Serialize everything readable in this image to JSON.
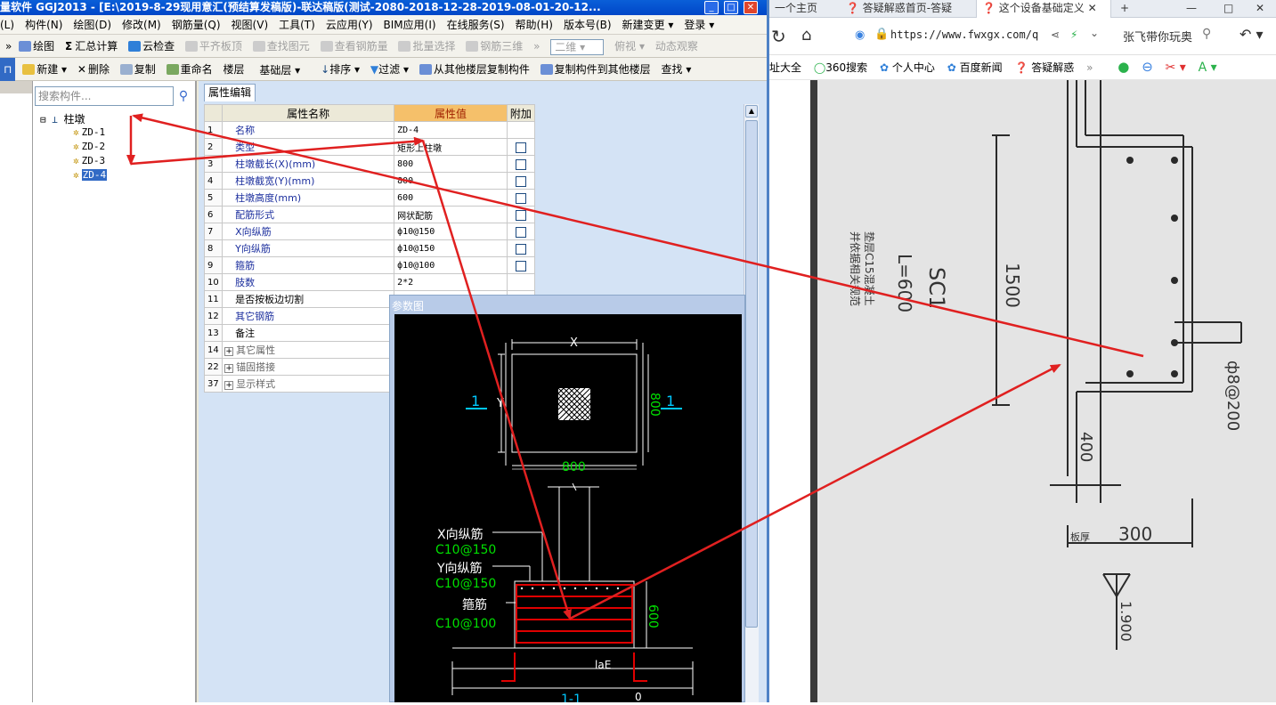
{
  "app": {
    "title": "量软件 GGJ2013 - [E:\\2019-8-29现用意汇(预结算发稿版)-联达稿版(测试-2080-2018-12-28-2019-08-01-20-12...",
    "menu": [
      "(L)",
      "构件(N)",
      "绘图(D)",
      "修改(M)",
      "钢筋量(Q)",
      "视图(V)",
      "工具(T)",
      "云应用(Y)",
      "BIM应用(I)",
      "在线服务(S)",
      "帮助(H)",
      "版本号(B)",
      "新建变更 ▾",
      "登录 ▾"
    ],
    "toolbar1": {
      "draw": "绘图",
      "sum": "汇总计算",
      "cloud_check": "云检查",
      "flat_top": "平齐板顶",
      "find_elem": "查找图元",
      "view_rebar": "查看钢筋量",
      "batch_select": "批量选择",
      "rebar_3d": "钢筋三维",
      "view_mode": "二维",
      "top_view": "俯视",
      "dyn_view": "动态观察"
    },
    "toolbar2": {
      "new": "新建",
      "delete": "删除",
      "copy": "复制",
      "rename": "重命名",
      "floor_label": "楼层",
      "floor_value": "基础层",
      "sort": "排序",
      "filter": "过滤",
      "copy_from": "从其他楼层复制构件",
      "copy_to": "复制构件到其他楼层",
      "find": "查找"
    },
    "tree": {
      "search_placeholder": "搜索构件...",
      "root": "柱墩",
      "items": [
        "ZD-1",
        "ZD-2",
        "ZD-3",
        "ZD-4"
      ],
      "selected": "ZD-4"
    },
    "props": {
      "tab": "属性编辑",
      "col_name": "属性名称",
      "col_value": "属性值",
      "col_extra": "附加",
      "rows": [
        {
          "no": "1",
          "name": "名称",
          "value": "ZD-4",
          "check": false
        },
        {
          "no": "2",
          "name": "类型",
          "value": "矩形上柱墩",
          "check": true
        },
        {
          "no": "3",
          "name": "柱墩截长(X)(mm)",
          "value": "800",
          "check": true
        },
        {
          "no": "4",
          "name": "柱墩截宽(Y)(mm)",
          "value": "800",
          "check": true
        },
        {
          "no": "5",
          "name": "柱墩高度(mm)",
          "value": "600",
          "check": true
        },
        {
          "no": "6",
          "name": "配筋形式",
          "value": "网状配筋",
          "check": true
        },
        {
          "no": "7",
          "name": "X向纵筋",
          "value": "ф10@150",
          "check": true
        },
        {
          "no": "8",
          "name": "Y向纵筋",
          "value": "ф10@150",
          "check": true
        },
        {
          "no": "9",
          "name": "箍筋",
          "value": "ф10@100",
          "check": true
        },
        {
          "no": "10",
          "name": "肢数",
          "value": "2*2",
          "check": false
        },
        {
          "no": "11",
          "name": "是否按板边切割",
          "value": "",
          "check": false
        },
        {
          "no": "12",
          "name": "其它钢筋",
          "value": "",
          "check": false
        },
        {
          "no": "13",
          "name": "备注",
          "value": "",
          "check": false
        },
        {
          "no": "14",
          "name": "其它属性",
          "value": "",
          "check": false
        },
        {
          "no": "22",
          "name": "锚固搭接",
          "value": "",
          "check": false
        },
        {
          "no": "37",
          "name": "显示样式",
          "value": "",
          "check": false
        }
      ]
    },
    "ref": {
      "title": "参数图",
      "x": "X",
      "y": "Y",
      "sec1": "1",
      "dim_x": "800",
      "dim_y": "800",
      "xbar": "X向纵筋",
      "xbar_val": "C10@150",
      "ybar": "Y向纵筋",
      "ybar_val": "C10@150",
      "stirrup": "箍筋",
      "stirrup_val": "C10@100",
      "height": "600",
      "lae": "laE",
      "section": "1-1",
      "zero": "0"
    }
  },
  "browser": {
    "tabs": [
      "一个主页",
      "答疑解惑首页-答疑",
      "这个设备基础定义"
    ],
    "url": "https://www.fwxgx.com/q",
    "search": "张飞带你玩奥",
    "favorites": [
      "址大全",
      "360搜索",
      "个人中心",
      "百度新闻",
      "答疑解惑"
    ],
    "drawing": {
      "label_sc": "SC1",
      "label_l": "L=600",
      "dim_1500": "1500",
      "dim_400": "400",
      "dim_300": "300",
      "rebar": "ф8@200",
      "floor": "板厚",
      "elev": "1.900",
      "note1": "垫层C15混凝土",
      "note2": "并依据相关规范"
    }
  },
  "colors": {
    "accent": "#0046c8",
    "arrow": "#e02020",
    "header_value": "#f5c06a"
  }
}
